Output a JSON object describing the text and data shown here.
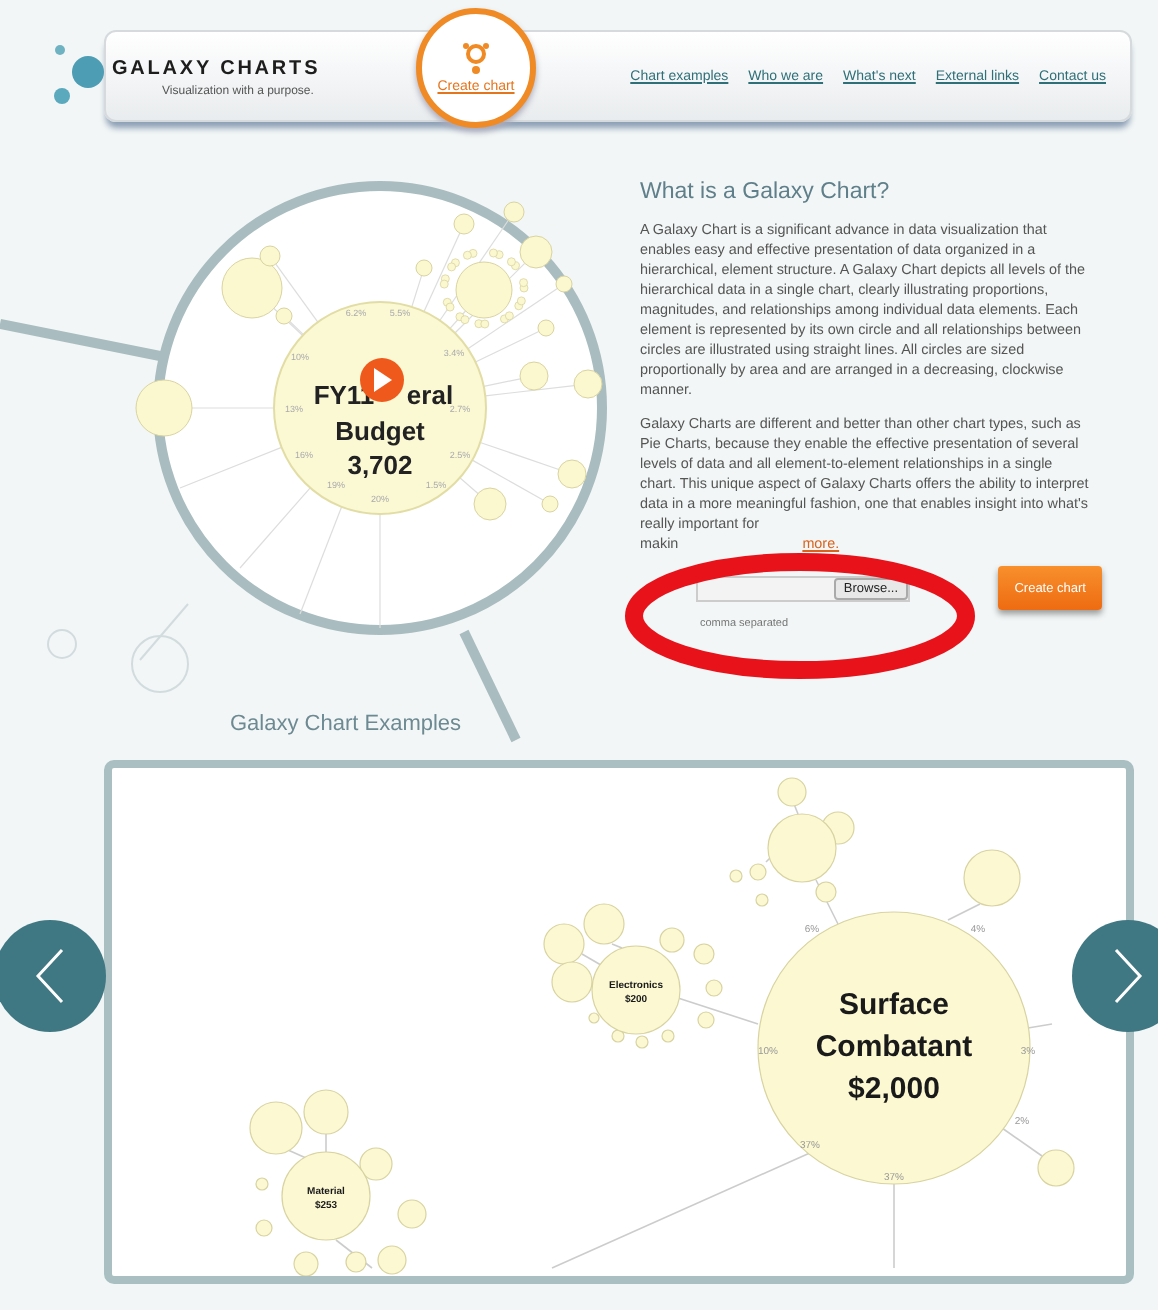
{
  "header": {
    "logo_title": "GALAXY CHARTS",
    "logo_tagline": "Visualization with a purpose.",
    "create_link": "Create chart",
    "nav": [
      {
        "label": "Chart examples"
      },
      {
        "label": "Who we are"
      },
      {
        "label": "What's next"
      },
      {
        "label": "External links"
      },
      {
        "label": "Contact us"
      }
    ]
  },
  "hero_chart": {
    "center_lines": [
      "FY11",
      "eral",
      "Budget",
      "3,702"
    ],
    "percent_labels": [
      "6.2%",
      "5.5%",
      "3.4%",
      "2.7%",
      "2.5%",
      "1.5%",
      "20%",
      "19%",
      "16%",
      "13%",
      "10%"
    ]
  },
  "intro": {
    "title": "What is a Galaxy Chart?",
    "paragraphs": [
      "A Galaxy Chart is a significant advance in data visualization that enables easy and effective presentation of data organized in a hierarchical, element structure. A Galaxy Chart depicts all levels of the hierarchical data in a single chart, clearly illustrating proportions, magnitudes, and relationships among individual data elements. Each element is represented by its own circle and all relationships between circles are illustrated using straight lines. All circles are sized proportionally by area and are arranged in a decreasing, clockwise manner.",
      "Galaxy Charts are different and better than other chart types, such as Pie Charts, because they enable the effective presentation of several levels of data and all element-to-element relationships in a single chart. This unique aspect of Galaxy Charts offers the ability to interpret data in a more meaningful fashion, one that enables insight into what's really important for"
    ],
    "cut_word": "makin",
    "more_link": "more.",
    "browse_button": "Browse...",
    "create_button": "Create chart",
    "hint": "comma separated"
  },
  "examples": {
    "title": "Galaxy Chart Examples",
    "nodes": [
      {
        "kind": "large",
        "label": "Surface Combatant",
        "value": "$2,000"
      },
      {
        "kind": "medium",
        "label": "Electronics",
        "value": "$200"
      },
      {
        "kind": "medium",
        "label": "Material",
        "value": "$253"
      }
    ],
    "percent_labels": [
      "6%",
      "4%",
      "10%",
      "3%",
      "37%",
      "2%",
      "37%"
    ]
  },
  "annotation": {
    "kind": "ellipse",
    "color": "#e8121a"
  }
}
